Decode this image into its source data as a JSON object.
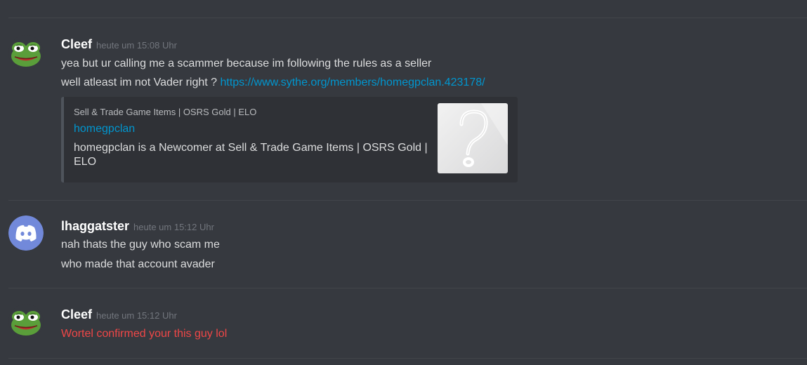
{
  "messages": [
    {
      "username": "Cleef",
      "timestamp": "heute um 15:08 Uhr",
      "avatar": "pepe-frog-avatar",
      "lines": [
        "yea but ur calling me a scammer because im following the rules as a seller",
        "well atleast im not Vader right ? "
      ],
      "link": "https://www.sythe.org/members/homegpclan.423178/",
      "embed": {
        "provider": "Sell & Trade Game Items | OSRS Gold | ELO",
        "title": "homegpclan",
        "description": "homegpclan is a Newcomer at Sell & Trade Game Items | OSRS Gold | ELO",
        "thumbnail": "question-mark-thumbnail"
      }
    },
    {
      "username": "lhaggatster",
      "timestamp": "heute um 15:12 Uhr",
      "avatar": "discord-logo-avatar",
      "lines": [
        "nah thats the guy who scam me",
        "who made that account avader"
      ]
    },
    {
      "username": "Cleef",
      "timestamp": "heute um 15:12 Uhr",
      "avatar": "pepe-frog-avatar",
      "lines": [
        "Wortel confirmed your this guy lol"
      ],
      "text_color": "#f04747"
    }
  ],
  "colors": {
    "background": "#36393f",
    "username": "#ffffff",
    "timestamp": "#72767d",
    "text": "#dcddde",
    "link": "#0096cf",
    "mention_red": "#f04747",
    "discord_blurple": "#7289da"
  }
}
